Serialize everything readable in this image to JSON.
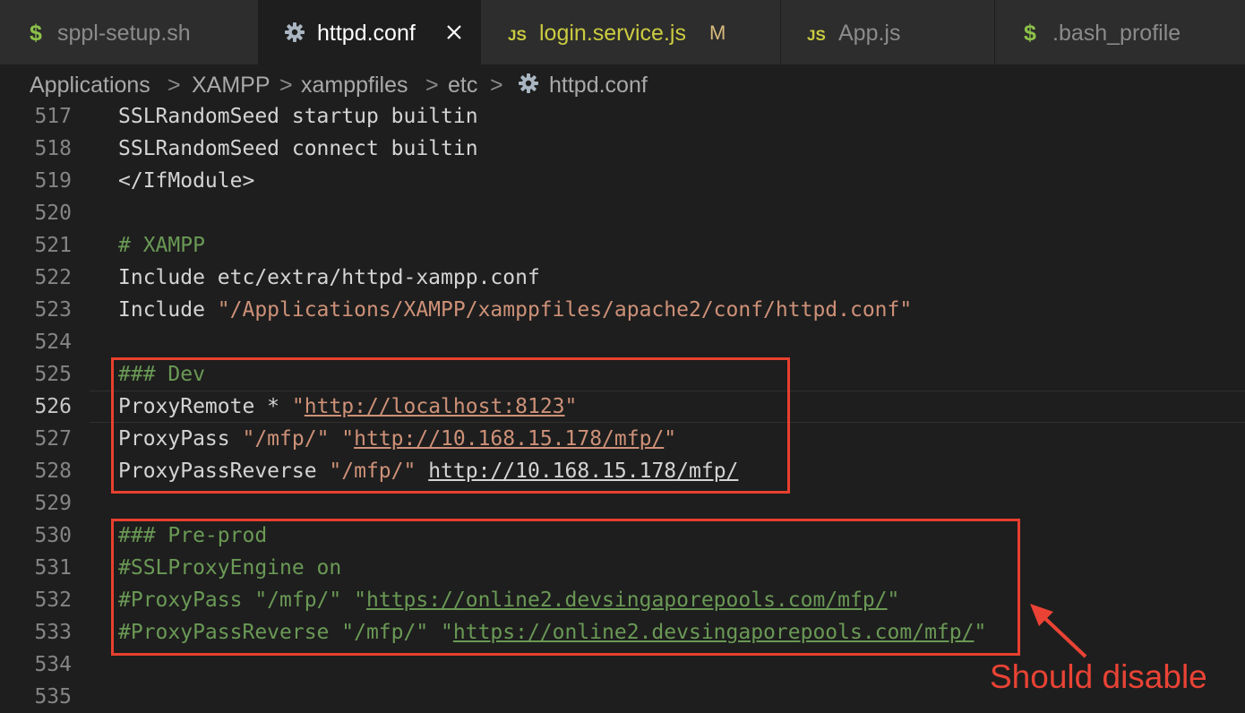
{
  "tabs": [
    {
      "icon": "$",
      "label": "sppl-setup.sh"
    },
    {
      "icon": "gear",
      "label": "httpd.conf",
      "active": true
    },
    {
      "icon": "JS",
      "label": "login.service.js",
      "badge": "M"
    },
    {
      "icon": "JS",
      "label": "App.js"
    },
    {
      "icon": "$",
      "label": ".bash_profile"
    }
  ],
  "breadcrumb": {
    "items": [
      "Applications",
      "XAMPP",
      "xamppfiles",
      "etc",
      "httpd.conf"
    ],
    "separator": ">"
  },
  "editor": {
    "current_line": "526",
    "lines": [
      {
        "n": "517",
        "parts": [
          "SSLRandomSeed startup builtin"
        ]
      },
      {
        "n": "518",
        "parts": [
          "SSLRandomSeed connect builtin"
        ]
      },
      {
        "n": "519",
        "parts": [
          "</IfModule>"
        ]
      },
      {
        "n": "520",
        "parts": [
          ""
        ]
      },
      {
        "n": "521",
        "parts": [
          "# XAMPP"
        ]
      },
      {
        "n": "522",
        "parts": [
          "Include etc/extra/httpd-xampp.conf"
        ]
      },
      {
        "n": "523",
        "parts": [
          "Include ",
          "\"/Applications/XAMPP/xamppfiles/apache2/conf/httpd.conf\""
        ]
      },
      {
        "n": "524",
        "parts": [
          ""
        ]
      },
      {
        "n": "525",
        "parts": [
          "### Dev"
        ]
      },
      {
        "n": "526",
        "parts": [
          "ProxyRemote * ",
          "\"",
          "http://localhost:8123",
          "\""
        ]
      },
      {
        "n": "527",
        "parts": [
          "ProxyPass ",
          "\"/mfp/\" \"",
          "http://10.168.15.178/mfp/",
          "\""
        ]
      },
      {
        "n": "528",
        "parts": [
          "ProxyPassReverse ",
          "\"/mfp/\"",
          " ",
          "http://10.168.15.178/mfp/"
        ]
      },
      {
        "n": "529",
        "parts": [
          ""
        ]
      },
      {
        "n": "530",
        "parts": [
          "### Pre-prod"
        ]
      },
      {
        "n": "531",
        "parts": [
          "#SSLProxyEngine on"
        ]
      },
      {
        "n": "532",
        "parts": [
          "#ProxyPass \"/mfp/\" \"",
          "https://online2.devsingaporepools.com/mfp/",
          "\""
        ]
      },
      {
        "n": "533",
        "parts": [
          "#ProxyPassReverse \"/mfp/\" \"",
          "https://online2.devsingaporepools.com/mfp/",
          "\""
        ]
      },
      {
        "n": "534",
        "parts": [
          ""
        ]
      },
      {
        "n": "535",
        "parts": [
          ""
        ]
      }
    ]
  },
  "annotation": {
    "text": "Should disable",
    "color": "#ea4335"
  },
  "colors": {
    "comment": "#6a9955",
    "string": "#ce9178",
    "text": "#d4d4d4",
    "highlight_box": "#e8402f"
  }
}
